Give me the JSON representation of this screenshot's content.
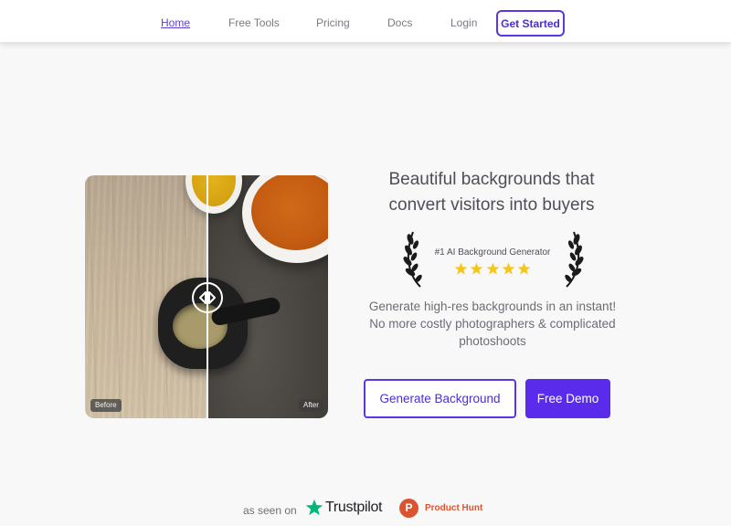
{
  "nav": {
    "items": [
      "Home",
      "Free Tools",
      "Pricing",
      "Docs",
      "Login"
    ],
    "cta": "Get Started"
  },
  "hero": {
    "headline_line1": "Beautiful backgrounds that",
    "headline_line2": "convert visitors into buyers",
    "award": "#1 AI Background Generator",
    "rating_stars": 5,
    "sub_line1": "Generate high-res backgrounds in an instant!",
    "sub_line2": "No more costly photographers & complicated",
    "sub_line3": "photoshoots",
    "primary_button": "Generate Background",
    "secondary_button": "Free Demo"
  },
  "comparison": {
    "before_label": "Before",
    "after_label": "After"
  },
  "seen_on": {
    "label": "as seen on",
    "trustpilot": "Trustpilot",
    "product_hunt": "Product Hunt",
    "product_hunt_letter": "P"
  },
  "colors": {
    "accent": "#5a2bea",
    "star": "#f5c518",
    "trustpilot_green": "#00b67a",
    "product_hunt": "#da552f"
  }
}
